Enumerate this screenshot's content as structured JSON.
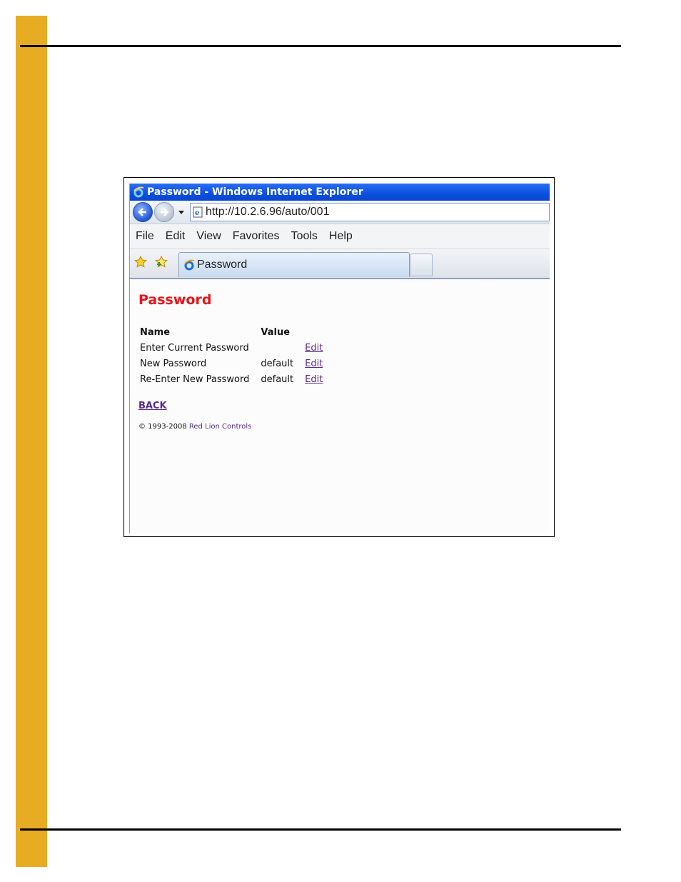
{
  "browser": {
    "window_title": "Password - Windows Internet Explorer",
    "address": "http://10.2.6.96/auto/001",
    "menu": [
      "File",
      "Edit",
      "View",
      "Favorites",
      "Tools",
      "Help"
    ],
    "tab_label": "Password"
  },
  "page": {
    "title": "Password",
    "table": {
      "headers": [
        "Name",
        "Value"
      ],
      "rows": [
        {
          "name": "Enter Current Password",
          "value": "",
          "action": "Edit"
        },
        {
          "name": "New Password",
          "value": "default",
          "action": "Edit"
        },
        {
          "name": "Re-Enter New Password",
          "value": "default",
          "action": "Edit"
        }
      ]
    },
    "back_label": "BACK",
    "copyright_prefix": "© 1993-2008",
    "copyright_link": "Red Lion Controls"
  },
  "colors": {
    "side_bar": "#e8ab24",
    "titlebar": "#0b4fe0",
    "page_title": "#e8141a",
    "link": "#5a2a8a"
  }
}
